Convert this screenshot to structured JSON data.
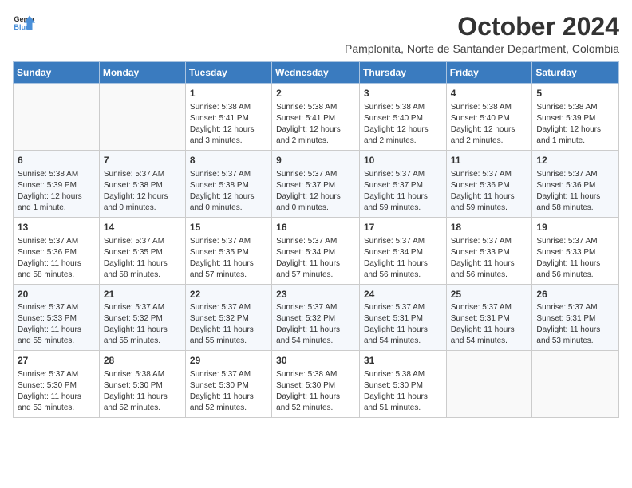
{
  "header": {
    "logo_general": "General",
    "logo_blue": "Blue",
    "title": "October 2024",
    "subtitle": "Pamplonita, Norte de Santander Department, Colombia"
  },
  "days_of_week": [
    "Sunday",
    "Monday",
    "Tuesday",
    "Wednesday",
    "Thursday",
    "Friday",
    "Saturday"
  ],
  "weeks": [
    [
      {
        "day": "",
        "content": ""
      },
      {
        "day": "",
        "content": ""
      },
      {
        "day": "1",
        "content": "Sunrise: 5:38 AM\nSunset: 5:41 PM\nDaylight: 12 hours and 3 minutes."
      },
      {
        "day": "2",
        "content": "Sunrise: 5:38 AM\nSunset: 5:41 PM\nDaylight: 12 hours and 2 minutes."
      },
      {
        "day": "3",
        "content": "Sunrise: 5:38 AM\nSunset: 5:40 PM\nDaylight: 12 hours and 2 minutes."
      },
      {
        "day": "4",
        "content": "Sunrise: 5:38 AM\nSunset: 5:40 PM\nDaylight: 12 hours and 2 minutes."
      },
      {
        "day": "5",
        "content": "Sunrise: 5:38 AM\nSunset: 5:39 PM\nDaylight: 12 hours and 1 minute."
      }
    ],
    [
      {
        "day": "6",
        "content": "Sunrise: 5:38 AM\nSunset: 5:39 PM\nDaylight: 12 hours and 1 minute."
      },
      {
        "day": "7",
        "content": "Sunrise: 5:37 AM\nSunset: 5:38 PM\nDaylight: 12 hours and 0 minutes."
      },
      {
        "day": "8",
        "content": "Sunrise: 5:37 AM\nSunset: 5:38 PM\nDaylight: 12 hours and 0 minutes."
      },
      {
        "day": "9",
        "content": "Sunrise: 5:37 AM\nSunset: 5:37 PM\nDaylight: 12 hours and 0 minutes."
      },
      {
        "day": "10",
        "content": "Sunrise: 5:37 AM\nSunset: 5:37 PM\nDaylight: 11 hours and 59 minutes."
      },
      {
        "day": "11",
        "content": "Sunrise: 5:37 AM\nSunset: 5:36 PM\nDaylight: 11 hours and 59 minutes."
      },
      {
        "day": "12",
        "content": "Sunrise: 5:37 AM\nSunset: 5:36 PM\nDaylight: 11 hours and 58 minutes."
      }
    ],
    [
      {
        "day": "13",
        "content": "Sunrise: 5:37 AM\nSunset: 5:36 PM\nDaylight: 11 hours and 58 minutes."
      },
      {
        "day": "14",
        "content": "Sunrise: 5:37 AM\nSunset: 5:35 PM\nDaylight: 11 hours and 58 minutes."
      },
      {
        "day": "15",
        "content": "Sunrise: 5:37 AM\nSunset: 5:35 PM\nDaylight: 11 hours and 57 minutes."
      },
      {
        "day": "16",
        "content": "Sunrise: 5:37 AM\nSunset: 5:34 PM\nDaylight: 11 hours and 57 minutes."
      },
      {
        "day": "17",
        "content": "Sunrise: 5:37 AM\nSunset: 5:34 PM\nDaylight: 11 hours and 56 minutes."
      },
      {
        "day": "18",
        "content": "Sunrise: 5:37 AM\nSunset: 5:33 PM\nDaylight: 11 hours and 56 minutes."
      },
      {
        "day": "19",
        "content": "Sunrise: 5:37 AM\nSunset: 5:33 PM\nDaylight: 11 hours and 56 minutes."
      }
    ],
    [
      {
        "day": "20",
        "content": "Sunrise: 5:37 AM\nSunset: 5:33 PM\nDaylight: 11 hours and 55 minutes."
      },
      {
        "day": "21",
        "content": "Sunrise: 5:37 AM\nSunset: 5:32 PM\nDaylight: 11 hours and 55 minutes."
      },
      {
        "day": "22",
        "content": "Sunrise: 5:37 AM\nSunset: 5:32 PM\nDaylight: 11 hours and 55 minutes."
      },
      {
        "day": "23",
        "content": "Sunrise: 5:37 AM\nSunset: 5:32 PM\nDaylight: 11 hours and 54 minutes."
      },
      {
        "day": "24",
        "content": "Sunrise: 5:37 AM\nSunset: 5:31 PM\nDaylight: 11 hours and 54 minutes."
      },
      {
        "day": "25",
        "content": "Sunrise: 5:37 AM\nSunset: 5:31 PM\nDaylight: 11 hours and 54 minutes."
      },
      {
        "day": "26",
        "content": "Sunrise: 5:37 AM\nSunset: 5:31 PM\nDaylight: 11 hours and 53 minutes."
      }
    ],
    [
      {
        "day": "27",
        "content": "Sunrise: 5:37 AM\nSunset: 5:30 PM\nDaylight: 11 hours and 53 minutes."
      },
      {
        "day": "28",
        "content": "Sunrise: 5:38 AM\nSunset: 5:30 PM\nDaylight: 11 hours and 52 minutes."
      },
      {
        "day": "29",
        "content": "Sunrise: 5:37 AM\nSunset: 5:30 PM\nDaylight: 11 hours and 52 minutes."
      },
      {
        "day": "30",
        "content": "Sunrise: 5:38 AM\nSunset: 5:30 PM\nDaylight: 11 hours and 52 minutes."
      },
      {
        "day": "31",
        "content": "Sunrise: 5:38 AM\nSunset: 5:30 PM\nDaylight: 11 hours and 51 minutes."
      },
      {
        "day": "",
        "content": ""
      },
      {
        "day": "",
        "content": ""
      }
    ]
  ]
}
